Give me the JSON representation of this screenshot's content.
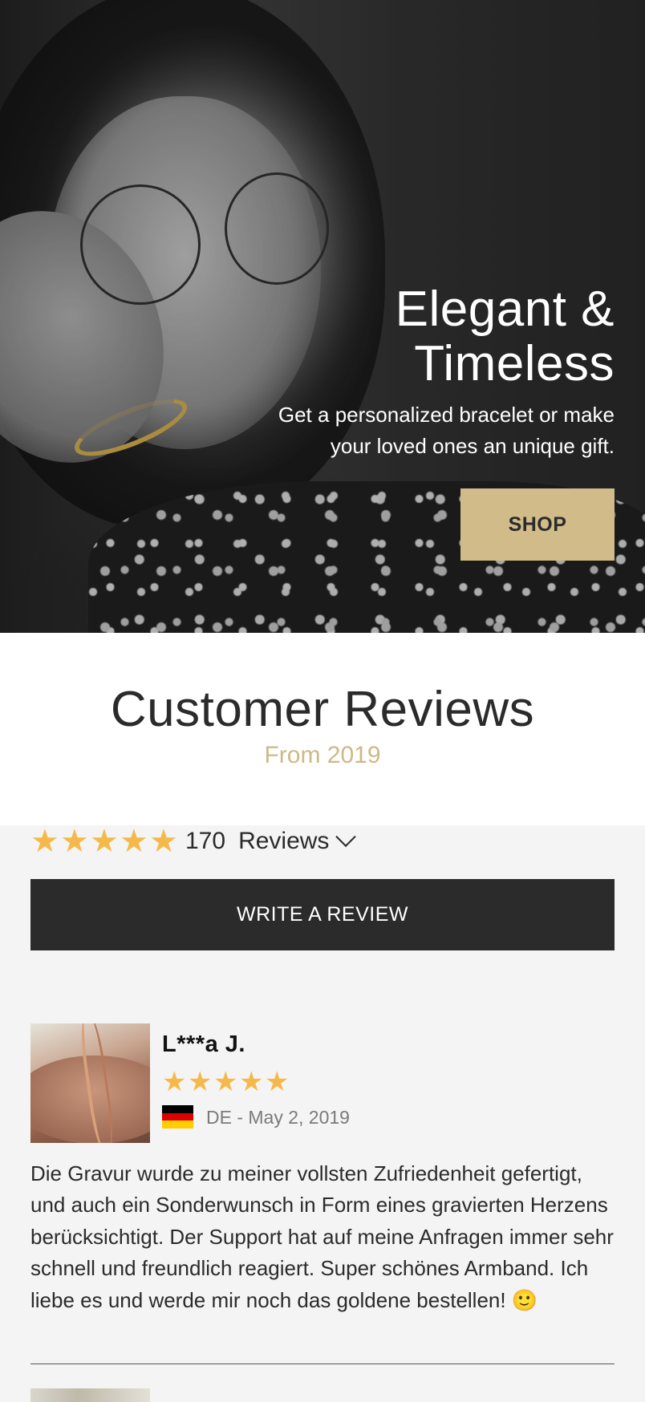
{
  "hero": {
    "title_line1": "Elegant &",
    "title_line2": "Timeless",
    "subtitle_line1": "Get a personalized bracelet or make",
    "subtitle_line2": "your loved ones an unique gift.",
    "shop_label": "SHOP"
  },
  "reviews_header": {
    "title": "Customer Reviews",
    "subtitle": "From 2019"
  },
  "summary": {
    "rating": 5,
    "count": "170",
    "label": "Reviews",
    "write_review_label": "WRITE A REVIEW"
  },
  "reviews": [
    {
      "name": "L***a J.",
      "rating": 5,
      "country_flag": "german-flag",
      "meta": "DE - May 2, 2019",
      "body": "Die Gravur wurde zu meiner vollsten Zufriedenheit gefertigt, und auch ein Sonderwunsch in Form eines gravierten Herzens berücksichtigt. Der Support hat auf meine Anfragen immer sehr schnell und freundlich reagiert. Super schönes Armband. Ich liebe es und werde mir noch das goldene bestellen! 🙂"
    }
  ],
  "colors": {
    "accent_gold": "#d0bb89",
    "dark": "#2b2b2b",
    "star": "#f5b94b",
    "background": "#f4f4f4"
  }
}
